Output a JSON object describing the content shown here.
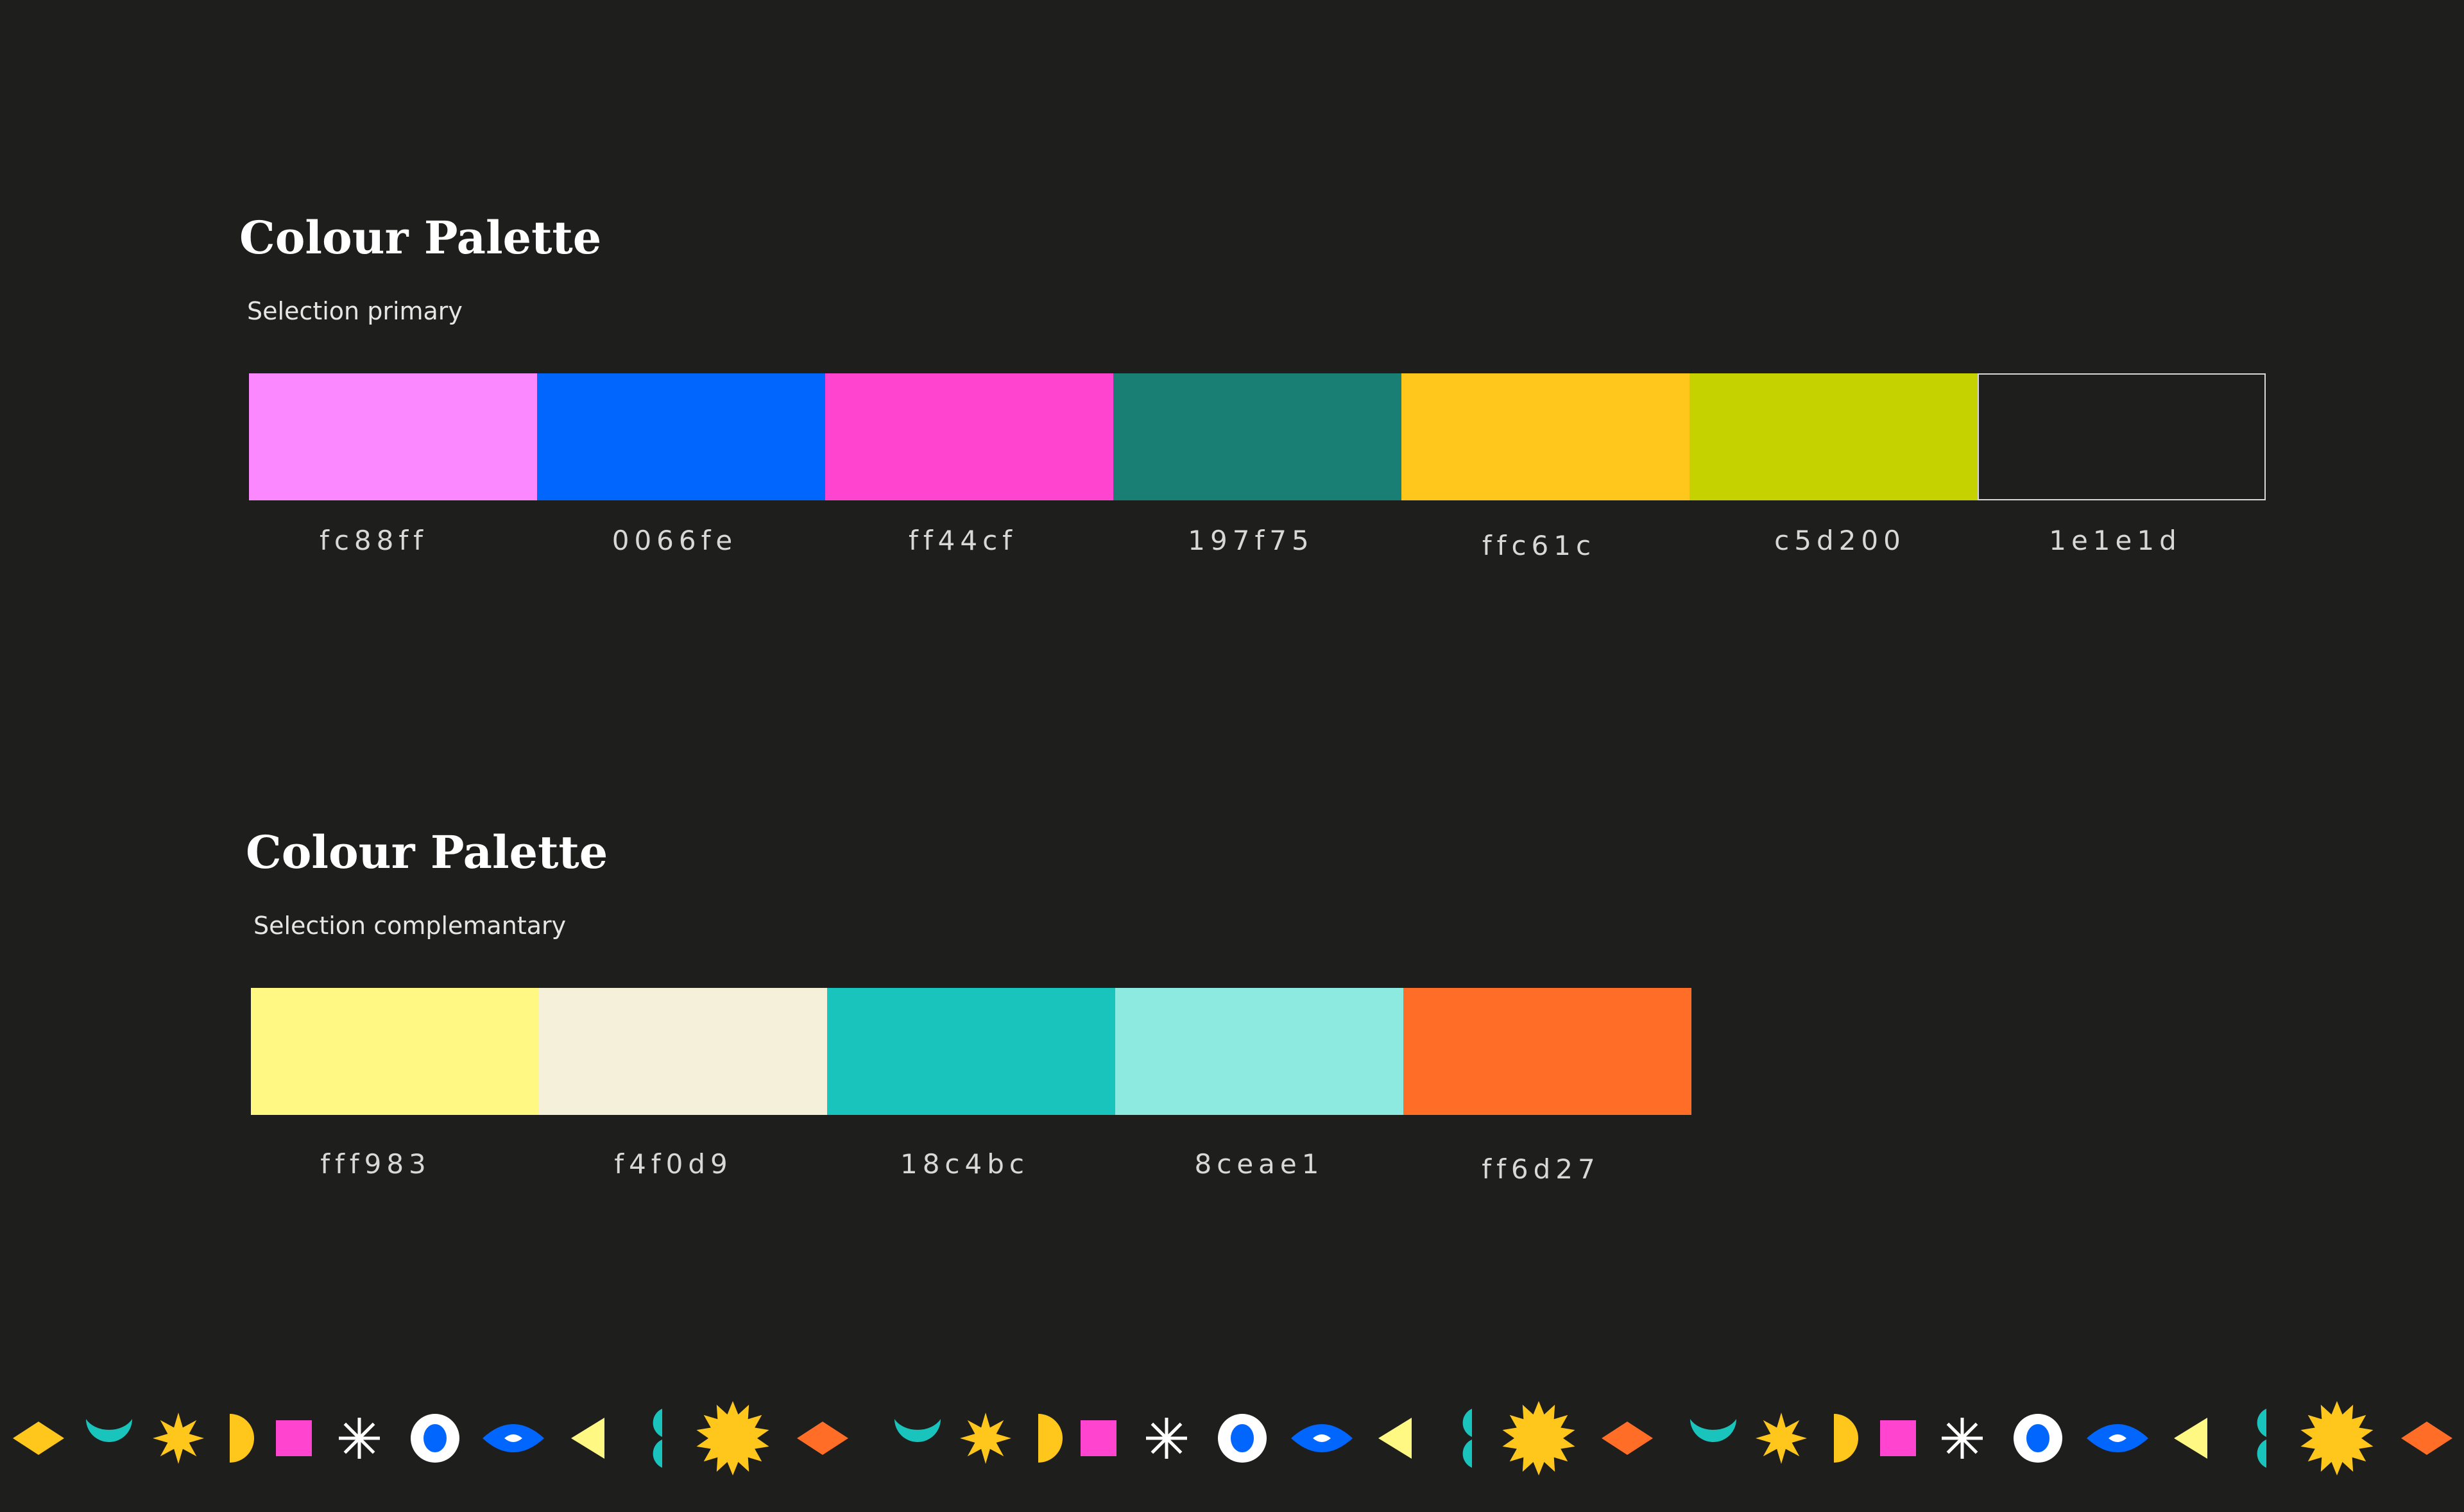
{
  "sections": [
    {
      "title": "Colour Palette",
      "subtitle": "Selection primary",
      "swatches": [
        {
          "code": "fc88ff",
          "color": "#fc88ff"
        },
        {
          "code": "0066fe",
          "color": "#0066fe"
        },
        {
          "code": "ff44cf",
          "color": "#ff44cf"
        },
        {
          "code": "197f75",
          "color": "#197f75"
        },
        {
          "code": "ffc61c",
          "color": "#ffc61c"
        },
        {
          "code": "c5d200",
          "color": "#c5d200"
        },
        {
          "code": "1e1e1d",
          "color": "#1e1e1d"
        }
      ]
    },
    {
      "title": "Colour Palette",
      "subtitle": "Selection complemantary",
      "swatches": [
        {
          "code": "fff983",
          "color": "#fff983"
        },
        {
          "code": "f4f0d9",
          "color": "#f4f0d9"
        },
        {
          "code": "18c4bc",
          "color": "#18c4bc"
        },
        {
          "code": "8ceae1",
          "color": "#8ceae1"
        },
        {
          "code": "ff6d27",
          "color": "#ff6d27"
        }
      ]
    }
  ],
  "shape_strip": [
    {
      "icon": "diamond-icon",
      "color": "#ffc61c"
    },
    {
      "icon": "crescent-icon",
      "color": "#18c4bc"
    },
    {
      "icon": "starburst-icon",
      "color": "#ffc61c"
    },
    {
      "icon": "half-circle-icon",
      "color": "#ffc61c"
    },
    {
      "icon": "square-icon",
      "color": "#ff44cf"
    },
    {
      "icon": "asterisk-icon",
      "color": "#ffffff"
    },
    {
      "icon": "eye-circle-icon",
      "color": "#0066fe"
    },
    {
      "icon": "eye-icon",
      "color": "#0066fe"
    },
    {
      "icon": "triangle-icon",
      "color": "#fff983"
    },
    {
      "icon": "double-half-circle-icon",
      "color": "#18c4bc"
    },
    {
      "icon": "sun-icon",
      "color": "#ffc61c"
    },
    {
      "icon": "diamond-icon",
      "color": "#ff6d27"
    }
  ]
}
